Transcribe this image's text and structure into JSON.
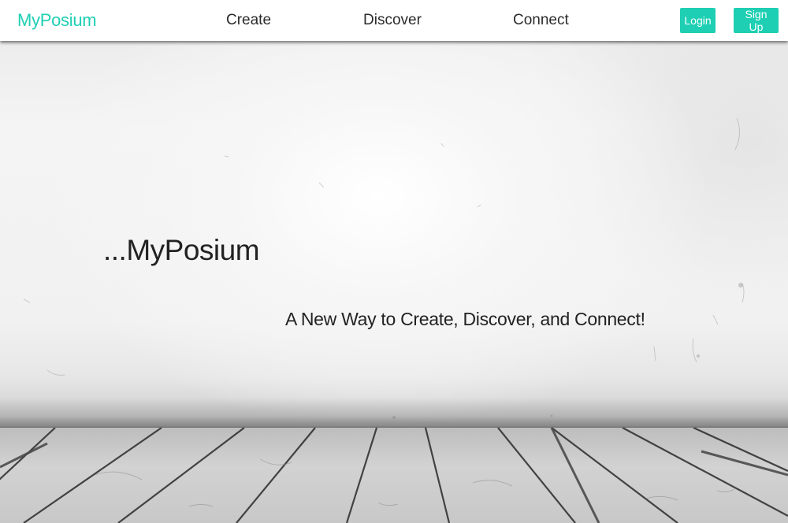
{
  "navbar": {
    "brand": "MyPosium",
    "links": [
      {
        "label": "Create"
      },
      {
        "label": "Discover"
      },
      {
        "label": "Connect"
      }
    ],
    "login_label": "Login",
    "signup_label": "Sign Up"
  },
  "hero": {
    "title": "...MyPosium",
    "tagline": "A New Way to Create, Discover, and Connect!"
  },
  "colors": {
    "accent": "#1ecfb3",
    "text": "#222222",
    "nav_background": "#ffffff"
  }
}
